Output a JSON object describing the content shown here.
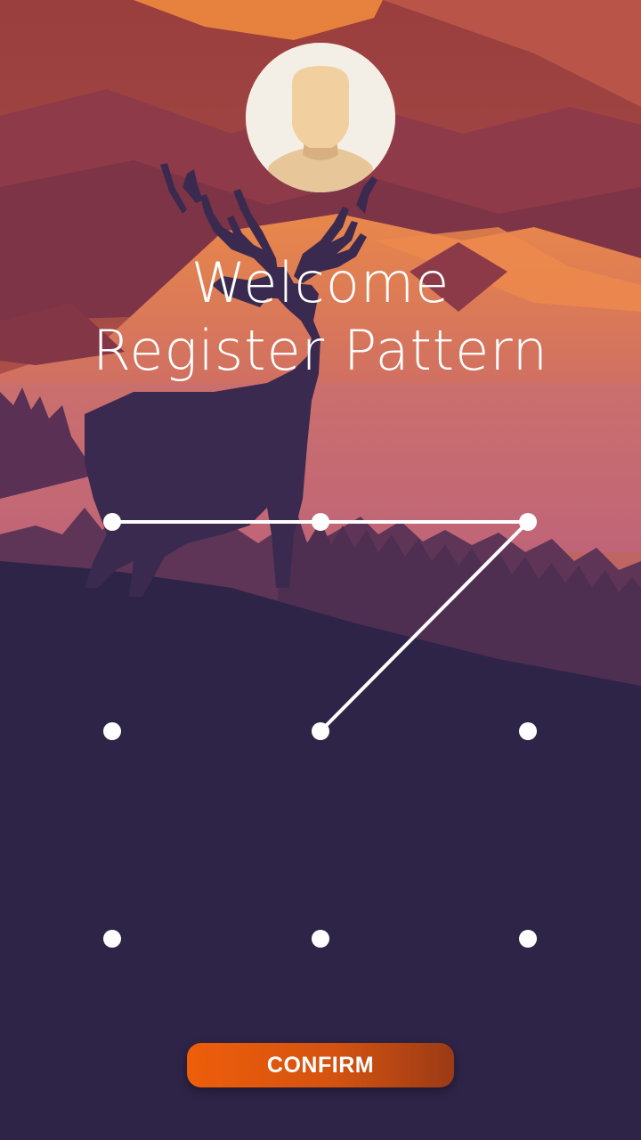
{
  "header": {
    "title_line1": "Welcome",
    "title_line2": "Register Pattern"
  },
  "avatar": {
    "icon": "user-avatar-icon"
  },
  "pattern": {
    "grid_size": 3,
    "selected_sequence": [
      1,
      2,
      3,
      5
    ],
    "line_color": "#ffffff",
    "dot_color": "#ffffff"
  },
  "actions": {
    "confirm_label": "CONFIRM"
  },
  "colors": {
    "accent": "#ee5e0a",
    "background_dark": "#2d2345",
    "sky_orange": "#e07a45"
  }
}
